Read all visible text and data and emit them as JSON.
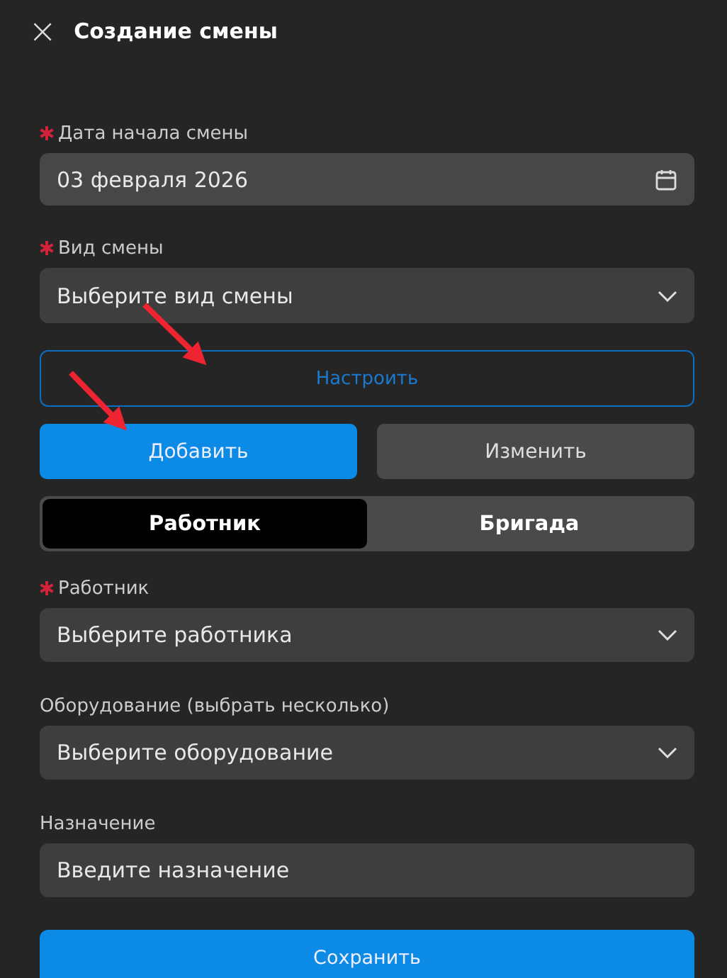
{
  "header": {
    "close": "×",
    "title": "Создание смены"
  },
  "fields_top": [
    {
      "kind": "date",
      "label": "Дата начала смены",
      "required": true,
      "value": "03 февраля 2026"
    },
    {
      "kind": "select",
      "label": "Вид смены",
      "required": true,
      "placeholder": "Выберите вид смены"
    }
  ],
  "configure_button": "Настроить",
  "actions": [
    {
      "label": "Добавить",
      "selected": true
    },
    {
      "label": "Изменить",
      "selected": false
    }
  ],
  "mode_tabs": [
    {
      "label": "Работник",
      "selected": true
    },
    {
      "label": "Бригада",
      "selected": false
    }
  ],
  "fields_bottom": [
    {
      "kind": "select",
      "label": "Работник",
      "required": true,
      "placeholder": "Выберите работника"
    },
    {
      "kind": "select",
      "label": "Оборудование (выбрать несколько)",
      "required": false,
      "placeholder": "Выберите оборудование"
    },
    {
      "kind": "text",
      "label": "Назначение",
      "required": false,
      "placeholder": "Введите назначение"
    }
  ],
  "save_button": "Сохранить",
  "annotations": [
    {
      "kind": "arrow"
    },
    {
      "kind": "arrow"
    }
  ]
}
